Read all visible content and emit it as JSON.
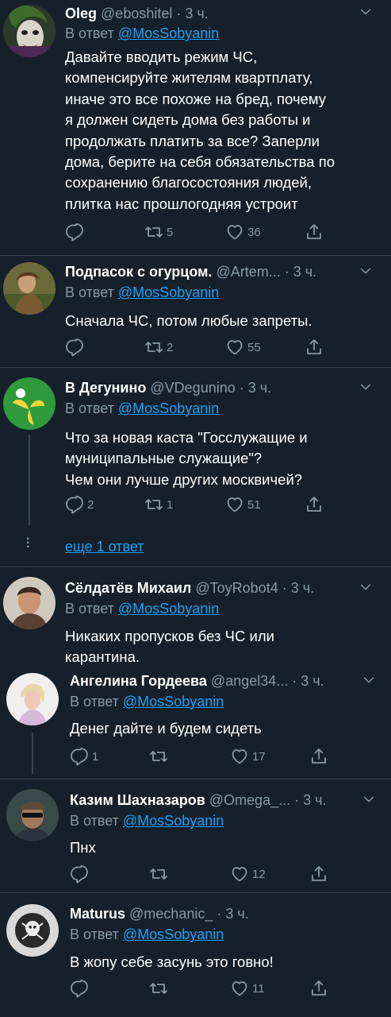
{
  "reply_prefix": "В ответ",
  "tweets": [
    {
      "name": "Oleg",
      "handle": "@eboshitel",
      "dot": "·",
      "time": "3 ч.",
      "reply_to": "@MosSobyanin",
      "text": "Давайте вводить режим ЧС,\nкомпенсируйте жителям квартплату,\nиначе это все похоже на бред, почему\nя должен сидеть дома без работы и\nпродолжать платить за все? Заперли\nдома, берите на себя обязательства по\nсохранению благосостояния людей,\nплитка нас прошлогодняя устроит",
      "replies": "",
      "retweets": "5",
      "likes": "36"
    },
    {
      "name": "Подпасок с огурцом.",
      "handle": "@Artem...",
      "dot": "·",
      "time": "3 ч.",
      "reply_to": "@MosSobyanin",
      "text": "Сначала ЧС, потом любые запреты.",
      "replies": "",
      "retweets": "2",
      "likes": "55"
    },
    {
      "name": "В Дегунино",
      "handle": "@VDegunino",
      "dot": "·",
      "time": "3 ч.",
      "reply_to": "@MosSobyanin",
      "text": "Что за новая каста \"Госслужащие и\nмуниципальные служащие\"?\nЧем они лучше других москвичей?",
      "replies": "2",
      "retweets": "1",
      "likes": "51"
    },
    {
      "name": "Сёлдатёв Михаил",
      "handle": "@ToyRobot4",
      "dot": "·",
      "time": "3 ч.",
      "reply_to": "@MosSobyanin",
      "text": "Никаких пропусков без ЧС или\nкарантина."
    },
    {
      "name": "Ангелина Гордеева",
      "handle": "@angel34...",
      "dot": "·",
      "time": "3 ч.",
      "reply_to": "@MosSobyanin",
      "text": "Денег дайте и будем сидеть",
      "replies": "1",
      "retweets": "",
      "likes": "17"
    },
    {
      "name": "Казим Шахназаров",
      "handle": "@Omega_...",
      "dot": "·",
      "time": "3 ч.",
      "reply_to": "@MosSobyanin",
      "text": "Пнх",
      "replies": "",
      "retweets": "",
      "likes": "12"
    },
    {
      "name": "Maturus",
      "handle": "@mechanic_",
      "dot": "·",
      "time": "3 ч.",
      "reply_to": "@MosSobyanin",
      "text": "В жопу себе засунь это говно!",
      "replies": "",
      "retweets": "",
      "likes": "11"
    }
  ],
  "more_replies": "еще 1 ответ",
  "icons": [
    "reply-icon",
    "retweet-icon",
    "like-icon",
    "share-icon",
    "chevron-down-icon",
    "more-dots-icon"
  ],
  "colors": {
    "background": "#15202b",
    "link": "#1da1f2",
    "muted": "#8899a6",
    "separator": "#38444d"
  }
}
